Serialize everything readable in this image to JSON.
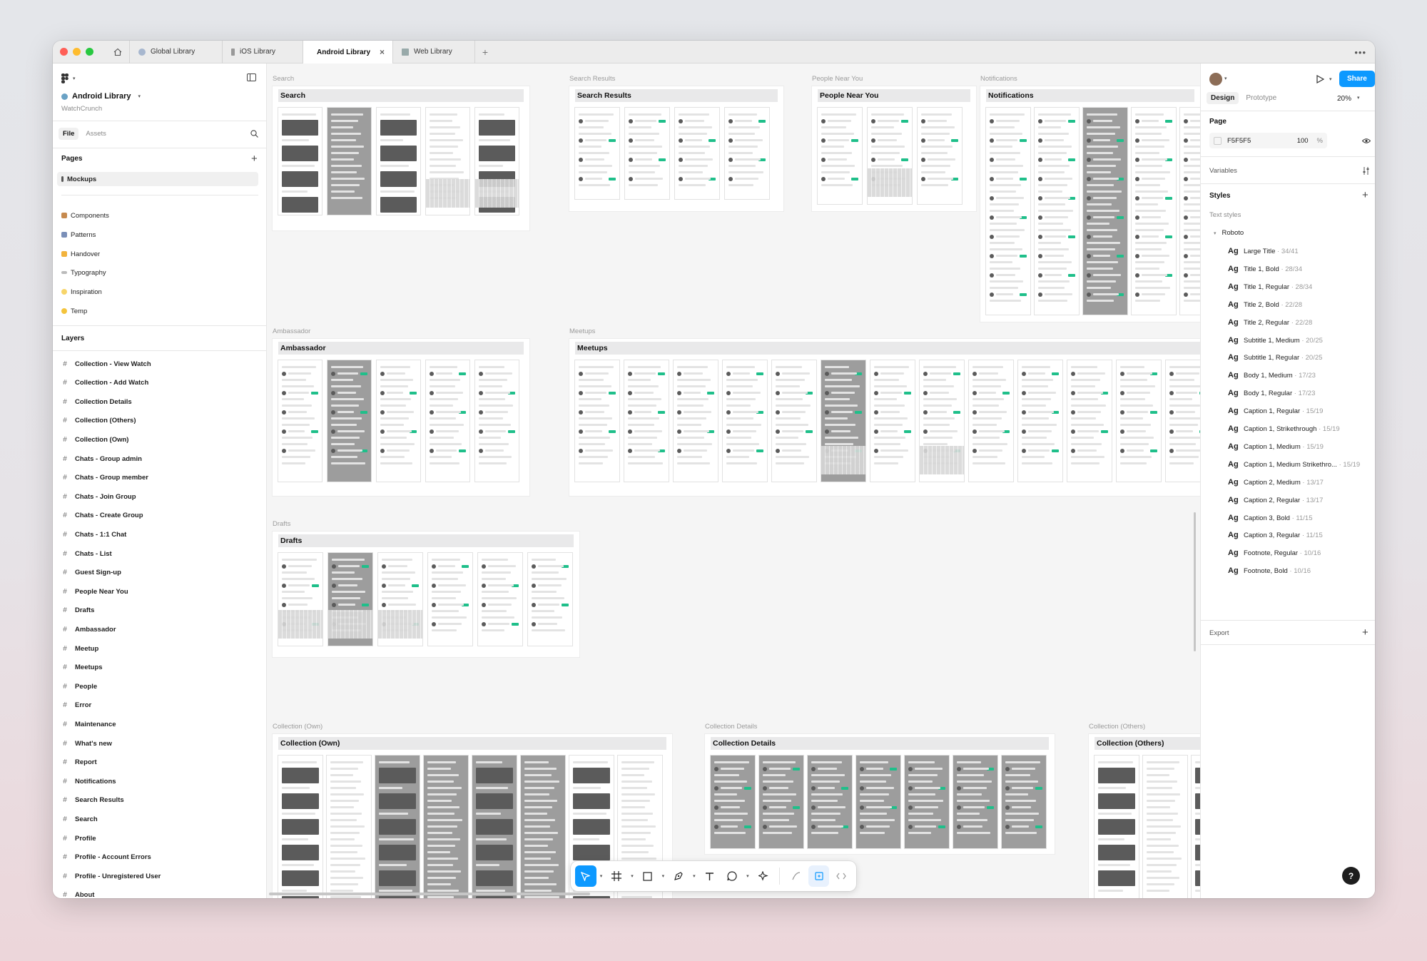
{
  "tabs": [
    {
      "label": "Global Library"
    },
    {
      "label": "iOS Library"
    },
    {
      "label": "Android Library",
      "active": true
    },
    {
      "label": "Web Library"
    }
  ],
  "file": {
    "name": "Android Library",
    "team": "WatchCrunch"
  },
  "left_tabs": {
    "file": "File",
    "assets": "Assets"
  },
  "pages": {
    "title": "Pages",
    "items": [
      "Mockups",
      "Components",
      "Patterns",
      "Handover",
      "Typography",
      "Inspiration",
      "Temp"
    ]
  },
  "layers": {
    "title": "Layers",
    "items": [
      "Collection - View Watch",
      "Collection - Add Watch",
      "Collection Details",
      "Collection (Others)",
      "Collection (Own)",
      "Chats - Group admin",
      "Chats - Group member",
      "Chats - Join Group",
      "Chats - Create Group",
      "Chats - 1:1 Chat",
      "Chats - List",
      "Guest Sign-up",
      "People Near You",
      "Drafts",
      "Ambassador",
      "Meetup",
      "Meetups",
      "People",
      "Error",
      "Maintenance",
      "What's new",
      "Report",
      "Notifications",
      "Search Results",
      "Search",
      "Profile",
      "Profile - Account Errors",
      "Profile - Unregistered User",
      "About"
    ]
  },
  "right": {
    "share": "Share",
    "design_tab": "Design",
    "prototype_tab": "Prototype",
    "zoom": "20%",
    "page_label": "Page",
    "page_color": "F5F5F5",
    "page_opacity": "100",
    "percent": "%",
    "variables": "Variables",
    "styles": "Styles",
    "text_styles": "Text styles",
    "font_group": "Roboto",
    "export": "Export",
    "text_style_items": [
      {
        "name": "Large Title",
        "size": "34/41"
      },
      {
        "name": "Title 1, Bold",
        "size": "28/34"
      },
      {
        "name": "Title 1, Regular",
        "size": "28/34"
      },
      {
        "name": "Title 2, Bold",
        "size": "22/28"
      },
      {
        "name": "Title 2, Regular",
        "size": "22/28"
      },
      {
        "name": "Subtitle 1, Medium",
        "size": "20/25"
      },
      {
        "name": "Subtitle 1, Regular",
        "size": "20/25"
      },
      {
        "name": "Body 1, Medium",
        "size": "17/23"
      },
      {
        "name": "Body 1, Regular",
        "size": "17/23"
      },
      {
        "name": "Caption 1, Regular",
        "size": "15/19"
      },
      {
        "name": "Caption 1, Strikethrough",
        "size": "15/19"
      },
      {
        "name": "Caption 1, Medium",
        "size": "15/19"
      },
      {
        "name": "Caption 1, Medium Strikethro...",
        "size": "15/19"
      },
      {
        "name": "Caption 2, Medium",
        "size": "13/17"
      },
      {
        "name": "Caption 2, Regular",
        "size": "13/17"
      },
      {
        "name": "Caption 3, Bold",
        "size": "11/15"
      },
      {
        "name": "Caption 3, Regular",
        "size": "11/15"
      },
      {
        "name": "Footnote, Regular",
        "size": "10/16"
      },
      {
        "name": "Footnote, Bold",
        "size": "10/16"
      }
    ]
  },
  "canvas_sections": [
    {
      "label": "Search",
      "title": "Search"
    },
    {
      "label": "Search Results",
      "title": "Search Results"
    },
    {
      "label": "People Near You",
      "title": "People Near You"
    },
    {
      "label": "Notifications",
      "title": "Notifications"
    },
    {
      "label": "Ambassador",
      "title": "Ambassador"
    },
    {
      "label": "Meetups",
      "title": "Meetups"
    },
    {
      "label": "Drafts",
      "title": "Drafts"
    },
    {
      "label": "Collection (Own)",
      "title": "Collection (Own)"
    },
    {
      "label": "Collection Details",
      "title": "Collection Details"
    },
    {
      "label": "Collection (Others)",
      "title": "Collection (Others)"
    }
  ],
  "help": "?",
  "colors": {
    "accent": "#0d99ff",
    "brand_green": "#1fbf8a",
    "canvas": "#f5f5f5"
  },
  "icons": [
    "home-icon",
    "sidebar-toggle-icon",
    "search-icon",
    "plus-icon",
    "eye-icon",
    "play-icon",
    "move-icon",
    "frame-icon",
    "rectangle-icon",
    "pen-icon",
    "text-icon",
    "comment-icon",
    "actions-icon",
    "dev-mode-icon"
  ]
}
